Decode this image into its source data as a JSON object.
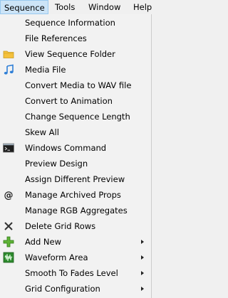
{
  "menubar": [
    "Sequence",
    "Tools",
    "Window",
    "Help"
  ],
  "menu_items": [
    {
      "label": "Sequence Information",
      "icon": null,
      "submenu": false
    },
    {
      "label": "File References",
      "icon": null,
      "submenu": false
    },
    {
      "label": "View Sequence Folder",
      "icon": "folder-icon",
      "submenu": false
    },
    {
      "label": "Media File",
      "icon": "music-note-icon",
      "submenu": false
    },
    {
      "label": "Convert Media to WAV file",
      "icon": null,
      "submenu": false
    },
    {
      "label": "Convert to Animation",
      "icon": null,
      "submenu": false
    },
    {
      "label": "Change Sequence Length",
      "icon": null,
      "submenu": false
    },
    {
      "label": "Skew All",
      "icon": null,
      "submenu": false
    },
    {
      "label": "Windows Command",
      "icon": "command-prompt-icon",
      "submenu": false
    },
    {
      "label": "Preview Design",
      "icon": null,
      "submenu": false
    },
    {
      "label": "Assign Different Preview",
      "icon": null,
      "submenu": false
    },
    {
      "label": "Manage Archived Props",
      "icon": "at-sign-icon",
      "submenu": false
    },
    {
      "label": "Manage RGB Aggregates",
      "icon": null,
      "submenu": false
    },
    {
      "label": "Delete Grid Rows",
      "icon": "x-icon",
      "submenu": false
    },
    {
      "label": "Add New",
      "icon": "green-plus-icon",
      "submenu": true
    },
    {
      "label": "Waveform Area",
      "icon": "waveform-icon",
      "submenu": true
    },
    {
      "label": "Smooth To Fades Level",
      "icon": null,
      "submenu": true
    },
    {
      "label": "Grid Configuration",
      "icon": null,
      "submenu": true
    }
  ]
}
